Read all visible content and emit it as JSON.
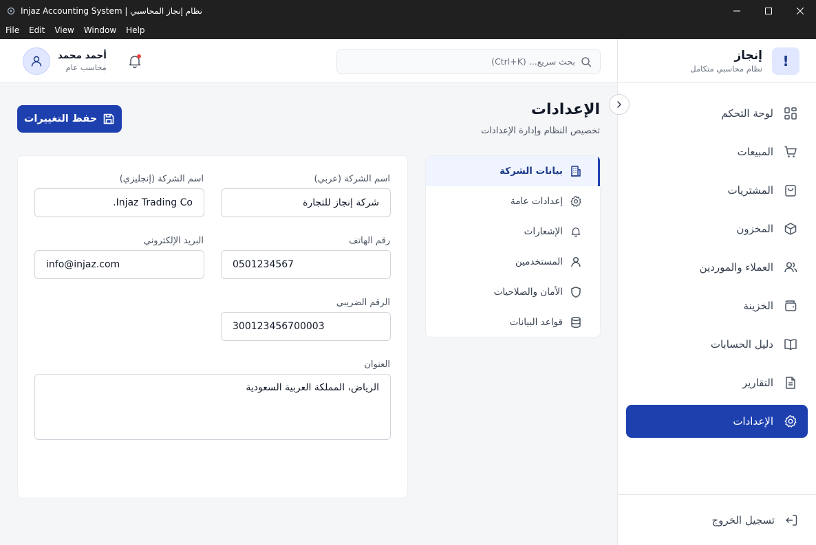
{
  "window": {
    "title": "Injaz Accounting System | نظام إنجاز المحاسبي"
  },
  "menu": [
    "File",
    "Edit",
    "View",
    "Window",
    "Help"
  ],
  "brand": {
    "logo_letter": "!",
    "name": "إنجاز",
    "subtitle": "نظام محاسبي متكامل"
  },
  "nav": {
    "items": [
      {
        "label": "لوحة التحكم",
        "icon": "dashboard-icon"
      },
      {
        "label": "المبيعات",
        "icon": "cart-icon"
      },
      {
        "label": "المشتريات",
        "icon": "shopping-bag-icon"
      },
      {
        "label": "المخزون",
        "icon": "box-icon"
      },
      {
        "label": "العملاء والموردين",
        "icon": "users-icon"
      },
      {
        "label": "الخزينة",
        "icon": "wallet-icon"
      },
      {
        "label": "دليل الحسابات",
        "icon": "book-icon"
      },
      {
        "label": "التقارير",
        "icon": "file-text-icon"
      },
      {
        "label": "الإعدادات",
        "icon": "gear-icon"
      }
    ],
    "active": "الإعدادات",
    "logout": "تسجيل الخروج"
  },
  "header": {
    "search_placeholder": "بحث سريع... (Ctrl+K)",
    "user_name": "أحمد محمد",
    "user_role": "محاسب عام"
  },
  "page": {
    "title": "الإعدادات",
    "subtitle": "تخصيص النظام وإدارة الإعدادات",
    "save_label": "حفظ التغييرات"
  },
  "tabs": [
    {
      "label": "بيانات الشركة",
      "icon": "building-icon"
    },
    {
      "label": "إعدادات عامة",
      "icon": "gear-icon"
    },
    {
      "label": "الإشعارات",
      "icon": "bell-icon"
    },
    {
      "label": "المستخدمين",
      "icon": "user-icon"
    },
    {
      "label": "الأمان والصلاحيات",
      "icon": "shield-icon"
    },
    {
      "label": "قواعد البيانات",
      "icon": "database-icon"
    }
  ],
  "form": {
    "company_name_ar": {
      "label": "اسم الشركة (عربي)",
      "value": "شركة إنجاز للتجارة"
    },
    "company_name_en": {
      "label": "اسم الشركة (إنجليزي)",
      "value": "Injaz Trading Co."
    },
    "phone": {
      "label": "رقم الهاتف",
      "value": "0501234567"
    },
    "email": {
      "label": "البريد الإلكتروني",
      "value": "info@injaz.com"
    },
    "tax_number": {
      "label": "الرقم الضريبي",
      "value": "300123456700003"
    },
    "address": {
      "label": "العنوان",
      "value": "الرياض، المملكة العربية السعودية"
    }
  },
  "colors": {
    "primary": "#1e40af",
    "titlebar": "#202020",
    "notification_dot": "#ef4444"
  }
}
